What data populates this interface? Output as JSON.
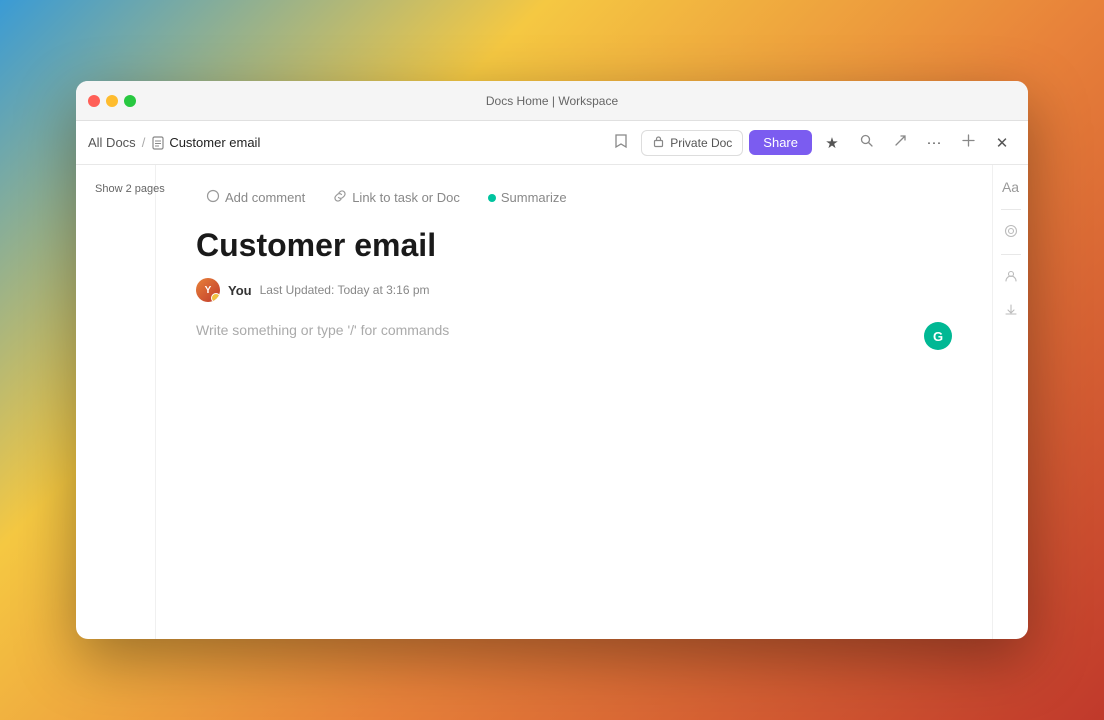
{
  "window": {
    "title": "Docs Home | Workspace"
  },
  "titlebar": {
    "close_label": "close",
    "minimize_label": "minimize",
    "maximize_label": "maximize"
  },
  "breadcrumb": {
    "all_docs": "All Docs",
    "separator": "/",
    "current_doc": "Customer email",
    "doc_icon": "📄"
  },
  "toolbar": {
    "private_doc_label": "Private Doc",
    "share_label": "Share",
    "lock_icon": "🔒",
    "star_icon": "★",
    "search_icon": "⌕",
    "export_icon": "↗",
    "more_icon": "···",
    "collapse_icon": "⤡",
    "close_icon": "✕"
  },
  "sidebar": {
    "show_pages_label": "Show 2 pages"
  },
  "floating_toolbar": {
    "add_comment_label": "Add comment",
    "link_task_label": "Link to task or Doc",
    "summarize_label": "Summarize",
    "comment_icon": "○",
    "link_icon": "⊘"
  },
  "document": {
    "title": "Customer email",
    "author": "You",
    "last_updated_label": "Last Updated:",
    "last_updated_value": "Today at 3:16 pm",
    "editor_placeholder": "Write something or type '/' for commands",
    "ai_badge": "G"
  },
  "right_sidebar": {
    "format_icon": "Aa",
    "align_icon": "≡",
    "share_icon": "👤",
    "download_icon": "↓"
  }
}
